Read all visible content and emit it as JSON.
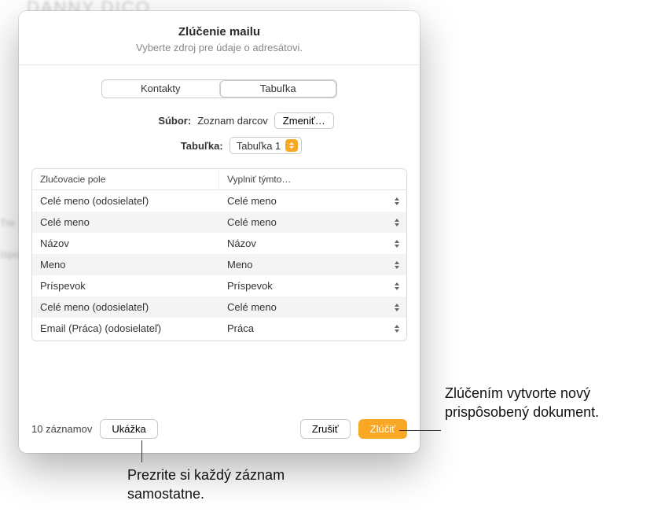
{
  "bg": {
    "title_fragment": "DANNY DICO",
    "side_label": "Tre",
    "side_label2": "íspo"
  },
  "sheet": {
    "title": "Zlúčenie mailu",
    "subtitle": "Vyberte zdroj pre údaje o adresátovi.",
    "tabs": {
      "a": "Kontakty",
      "b": "Tabuľka"
    },
    "file": {
      "label": "Súbor:",
      "value": "Zoznam darcov",
      "change_btn": "Zmeniť…"
    },
    "table_select": {
      "label": "Tabuľka:",
      "value": "Tabuľka 1"
    },
    "columns": {
      "a": "Zlučovacie pole",
      "b": "Vyplniť týmto…"
    },
    "rows": [
      {
        "field": "Celé meno (odosielateľ)",
        "fill": "Celé meno"
      },
      {
        "field": "Celé meno",
        "fill": "Celé meno"
      },
      {
        "field": "Názov",
        "fill": "Názov"
      },
      {
        "field": "Meno",
        "fill": "Meno"
      },
      {
        "field": "Príspevok",
        "fill": "Príspevok"
      },
      {
        "field": "Celé meno (odosielateľ)",
        "fill": "Celé meno"
      },
      {
        "field": "Email (Práca) (odosielateľ)",
        "fill": "Práca"
      }
    ],
    "footer": {
      "count": "10 záznamov",
      "preview": "Ukážka",
      "cancel": "Zrušiť",
      "merge": "Zlúčiť"
    }
  },
  "callouts": {
    "merge": "Zlúčením vytvorte nový prispôsobený dokument.",
    "preview": "Prezrite si každý záznam samostatne."
  }
}
